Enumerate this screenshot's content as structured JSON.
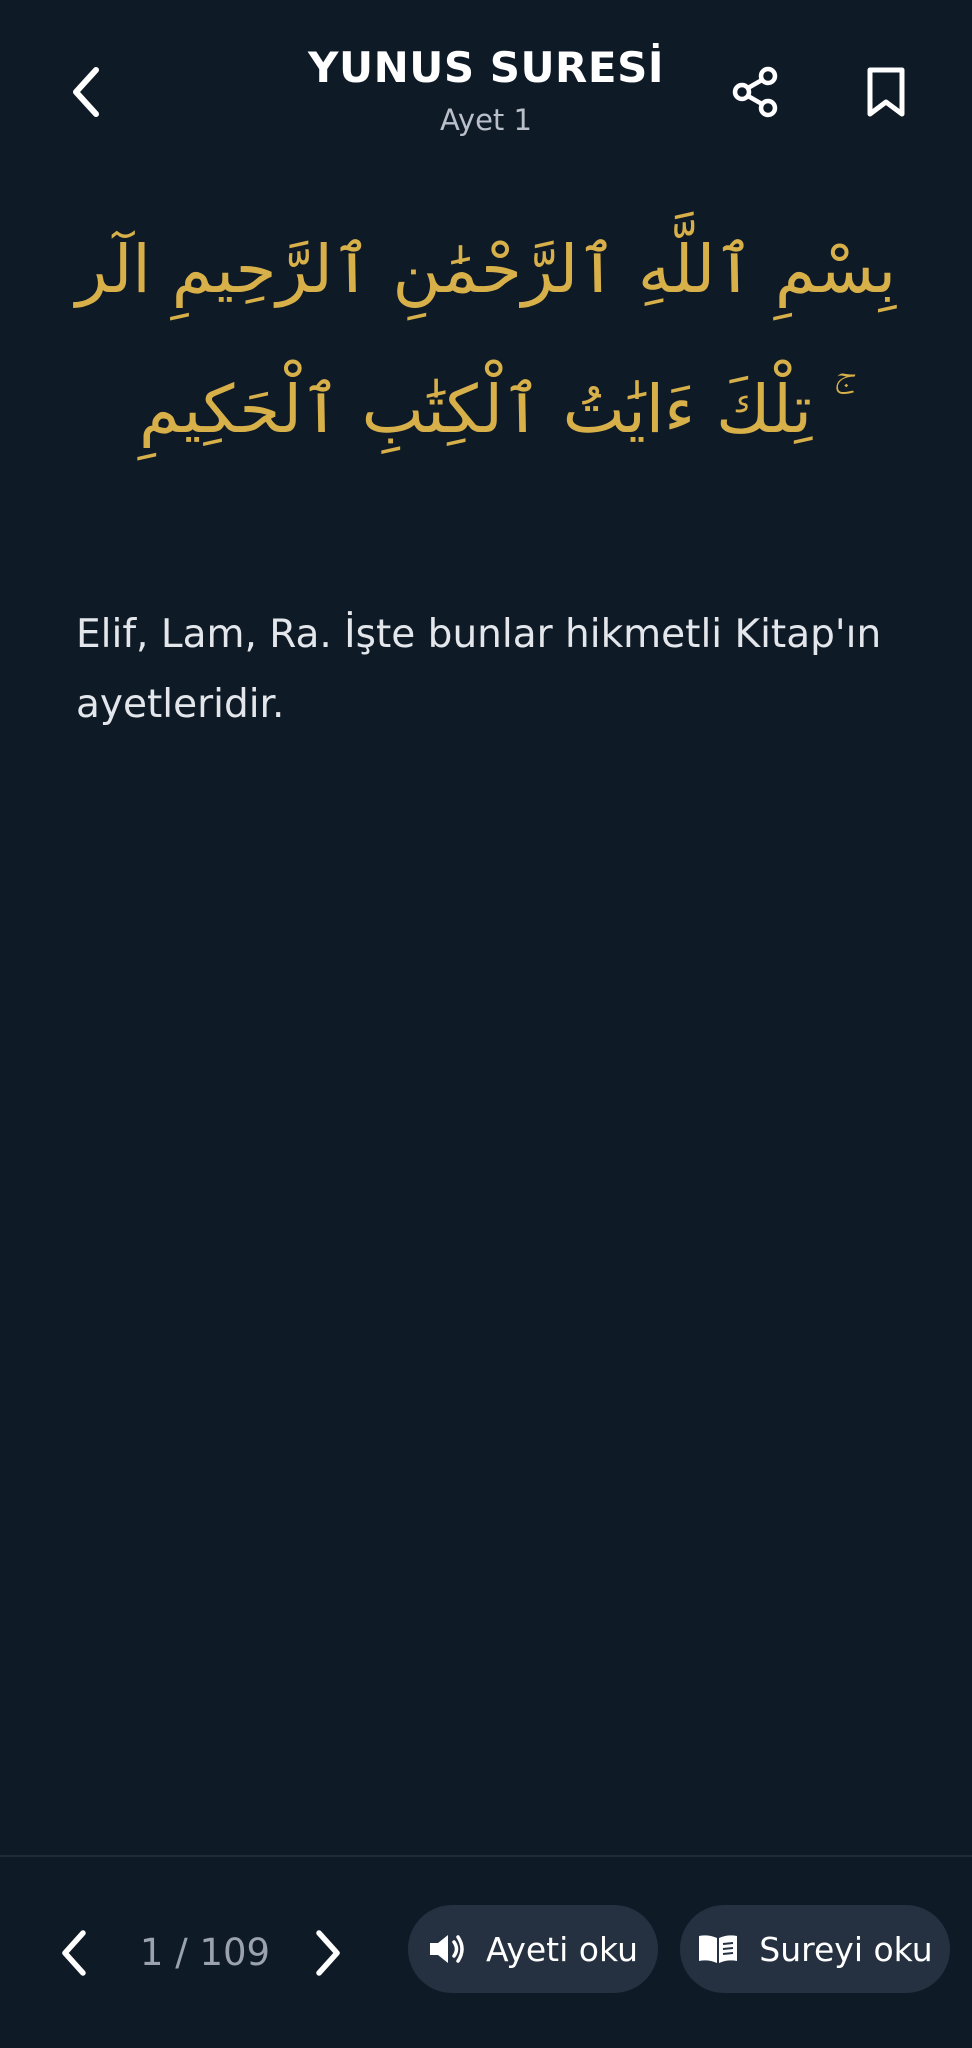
{
  "header": {
    "title": "YUNUS SURESİ",
    "subtitle": "Ayet 1",
    "back_icon": "chevron-left-icon",
    "share_icon": "share-icon",
    "bookmark_icon": "bookmark-icon"
  },
  "verse": {
    "arabic": "بِسْمِ ٱللَّهِ ٱلرَّحْمَٰنِ ٱلرَّحِيمِ الٓر ۚ تِلْكَ ءَايَٰتُ ٱلْكِتَٰبِ ٱلْحَكِيمِ",
    "translation": "Elif, Lam, Ra. İşte bunlar hikmetli Kitap'ın ayetleridir."
  },
  "footer": {
    "pager": "1 / 109",
    "read_verse_label": "Ayeti oku",
    "read_surah_label": "Sureyi oku",
    "prev_icon": "chevron-left-icon",
    "next_icon": "chevron-right-icon",
    "speaker_icon": "speaker-icon",
    "book_icon": "open-book-icon"
  },
  "colors": {
    "background": "#0f1a27",
    "arabic_gold": "#d8b04a",
    "pill_bg": "#253140",
    "muted_text": "#9aa3ad"
  }
}
